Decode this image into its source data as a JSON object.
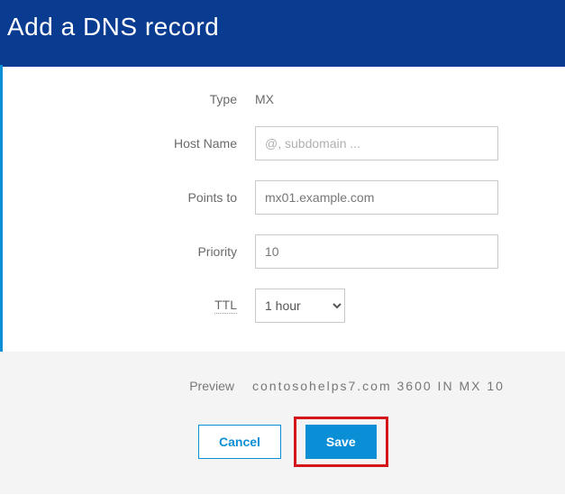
{
  "header": {
    "title": "Add a DNS record"
  },
  "form": {
    "type_label": "Type",
    "type_value": "MX",
    "hostname_label": "Host Name",
    "hostname_placeholder": "@, subdomain ...",
    "hostname_value": "",
    "pointsto_label": "Points to",
    "pointsto_value": "mx01.example.com",
    "priority_label": "Priority",
    "priority_value": "10",
    "ttl_label": "TTL",
    "ttl_value": "1 hour"
  },
  "footer": {
    "preview_label": "Preview",
    "preview_text": "contosohelps7.com  3600  IN  MX  10",
    "cancel_label": "Cancel",
    "save_label": "Save"
  }
}
